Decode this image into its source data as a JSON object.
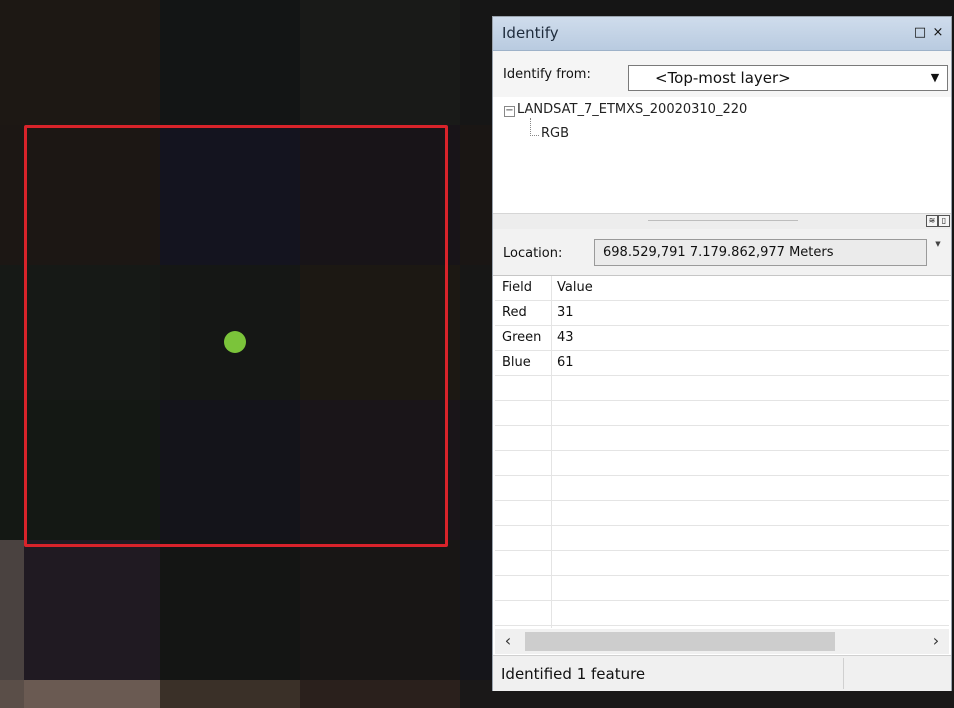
{
  "map": {
    "colors": {
      "selection": "#d8232a",
      "point": "#7bc43a"
    }
  },
  "identify": {
    "title": "Identify",
    "buttons": {
      "maximize": "□",
      "close": "×"
    },
    "from_label": "Identify from:",
    "from_value": "<Top-most layer>",
    "tree": {
      "layer": "LANDSAT_7_ETMXS_20020310_220",
      "child": "RGB"
    },
    "location_label": "Location:",
    "location_value": "698.529,791  7.179.862,977 Meters",
    "table": {
      "headers": [
        "Field",
        "Value"
      ],
      "rows": [
        {
          "field": "Red",
          "value": "31"
        },
        {
          "field": "Green",
          "value": "43"
        },
        {
          "field": "Blue",
          "value": "61"
        }
      ]
    },
    "status": "Identified 1 feature"
  }
}
